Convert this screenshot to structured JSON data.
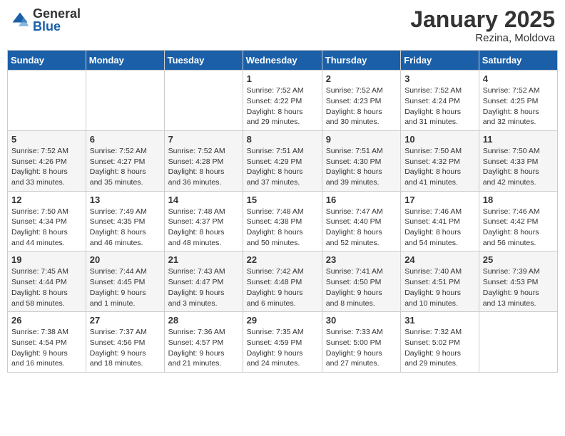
{
  "header": {
    "logo_general": "General",
    "logo_blue": "Blue",
    "month_title": "January 2025",
    "location": "Rezina, Moldova"
  },
  "weekdays": [
    "Sunday",
    "Monday",
    "Tuesday",
    "Wednesday",
    "Thursday",
    "Friday",
    "Saturday"
  ],
  "weeks": [
    [
      {
        "day": "",
        "info": ""
      },
      {
        "day": "",
        "info": ""
      },
      {
        "day": "",
        "info": ""
      },
      {
        "day": "1",
        "info": "Sunrise: 7:52 AM\nSunset: 4:22 PM\nDaylight: 8 hours\nand 29 minutes."
      },
      {
        "day": "2",
        "info": "Sunrise: 7:52 AM\nSunset: 4:23 PM\nDaylight: 8 hours\nand 30 minutes."
      },
      {
        "day": "3",
        "info": "Sunrise: 7:52 AM\nSunset: 4:24 PM\nDaylight: 8 hours\nand 31 minutes."
      },
      {
        "day": "4",
        "info": "Sunrise: 7:52 AM\nSunset: 4:25 PM\nDaylight: 8 hours\nand 32 minutes."
      }
    ],
    [
      {
        "day": "5",
        "info": "Sunrise: 7:52 AM\nSunset: 4:26 PM\nDaylight: 8 hours\nand 33 minutes."
      },
      {
        "day": "6",
        "info": "Sunrise: 7:52 AM\nSunset: 4:27 PM\nDaylight: 8 hours\nand 35 minutes."
      },
      {
        "day": "7",
        "info": "Sunrise: 7:52 AM\nSunset: 4:28 PM\nDaylight: 8 hours\nand 36 minutes."
      },
      {
        "day": "8",
        "info": "Sunrise: 7:51 AM\nSunset: 4:29 PM\nDaylight: 8 hours\nand 37 minutes."
      },
      {
        "day": "9",
        "info": "Sunrise: 7:51 AM\nSunset: 4:30 PM\nDaylight: 8 hours\nand 39 minutes."
      },
      {
        "day": "10",
        "info": "Sunrise: 7:50 AM\nSunset: 4:32 PM\nDaylight: 8 hours\nand 41 minutes."
      },
      {
        "day": "11",
        "info": "Sunrise: 7:50 AM\nSunset: 4:33 PM\nDaylight: 8 hours\nand 42 minutes."
      }
    ],
    [
      {
        "day": "12",
        "info": "Sunrise: 7:50 AM\nSunset: 4:34 PM\nDaylight: 8 hours\nand 44 minutes."
      },
      {
        "day": "13",
        "info": "Sunrise: 7:49 AM\nSunset: 4:35 PM\nDaylight: 8 hours\nand 46 minutes."
      },
      {
        "day": "14",
        "info": "Sunrise: 7:48 AM\nSunset: 4:37 PM\nDaylight: 8 hours\nand 48 minutes."
      },
      {
        "day": "15",
        "info": "Sunrise: 7:48 AM\nSunset: 4:38 PM\nDaylight: 8 hours\nand 50 minutes."
      },
      {
        "day": "16",
        "info": "Sunrise: 7:47 AM\nSunset: 4:40 PM\nDaylight: 8 hours\nand 52 minutes."
      },
      {
        "day": "17",
        "info": "Sunrise: 7:46 AM\nSunset: 4:41 PM\nDaylight: 8 hours\nand 54 minutes."
      },
      {
        "day": "18",
        "info": "Sunrise: 7:46 AM\nSunset: 4:42 PM\nDaylight: 8 hours\nand 56 minutes."
      }
    ],
    [
      {
        "day": "19",
        "info": "Sunrise: 7:45 AM\nSunset: 4:44 PM\nDaylight: 8 hours\nand 58 minutes."
      },
      {
        "day": "20",
        "info": "Sunrise: 7:44 AM\nSunset: 4:45 PM\nDaylight: 9 hours\nand 1 minute."
      },
      {
        "day": "21",
        "info": "Sunrise: 7:43 AM\nSunset: 4:47 PM\nDaylight: 9 hours\nand 3 minutes."
      },
      {
        "day": "22",
        "info": "Sunrise: 7:42 AM\nSunset: 4:48 PM\nDaylight: 9 hours\nand 6 minutes."
      },
      {
        "day": "23",
        "info": "Sunrise: 7:41 AM\nSunset: 4:50 PM\nDaylight: 9 hours\nand 8 minutes."
      },
      {
        "day": "24",
        "info": "Sunrise: 7:40 AM\nSunset: 4:51 PM\nDaylight: 9 hours\nand 10 minutes."
      },
      {
        "day": "25",
        "info": "Sunrise: 7:39 AM\nSunset: 4:53 PM\nDaylight: 9 hours\nand 13 minutes."
      }
    ],
    [
      {
        "day": "26",
        "info": "Sunrise: 7:38 AM\nSunset: 4:54 PM\nDaylight: 9 hours\nand 16 minutes."
      },
      {
        "day": "27",
        "info": "Sunrise: 7:37 AM\nSunset: 4:56 PM\nDaylight: 9 hours\nand 18 minutes."
      },
      {
        "day": "28",
        "info": "Sunrise: 7:36 AM\nSunset: 4:57 PM\nDaylight: 9 hours\nand 21 minutes."
      },
      {
        "day": "29",
        "info": "Sunrise: 7:35 AM\nSunset: 4:59 PM\nDaylight: 9 hours\nand 24 minutes."
      },
      {
        "day": "30",
        "info": "Sunrise: 7:33 AM\nSunset: 5:00 PM\nDaylight: 9 hours\nand 27 minutes."
      },
      {
        "day": "31",
        "info": "Sunrise: 7:32 AM\nSunset: 5:02 PM\nDaylight: 9 hours\nand 29 minutes."
      },
      {
        "day": "",
        "info": ""
      }
    ]
  ]
}
